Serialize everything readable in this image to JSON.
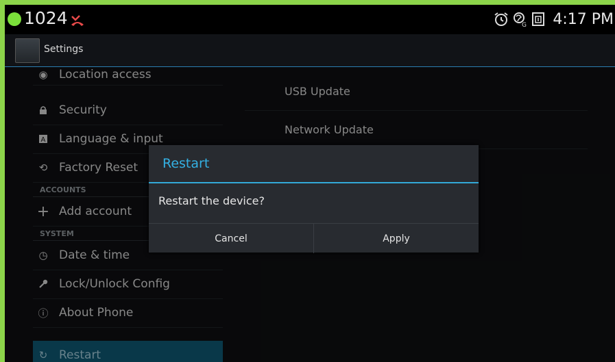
{
  "status_bar": {
    "extension": "1024",
    "time": "4:17 PM",
    "icons": [
      "green-status-dot-icon",
      "missed-call-icon",
      "alarm-clock-icon",
      "gps-icon",
      "sim-slot-1-icon"
    ]
  },
  "action_bar": {
    "title": "Settings",
    "icon": "settings-app-icon"
  },
  "sidebar": {
    "items": [
      {
        "label": "Location access",
        "icon": "location-icon"
      },
      {
        "label": "Security",
        "icon": "lock-icon"
      },
      {
        "label": "Language & input",
        "icon": "keyboard-icon"
      },
      {
        "label": "Factory Reset",
        "icon": "factory-reset-icon"
      },
      {
        "label": "ACCOUNTS",
        "header": true
      },
      {
        "label": "Add account",
        "icon": "plus-icon"
      },
      {
        "label": "SYSTEM",
        "header": true
      },
      {
        "label": "Date & time",
        "icon": "clock-icon"
      },
      {
        "label": "Lock/Unlock Config",
        "icon": "key-icon"
      },
      {
        "label": "About Phone",
        "icon": "info-icon"
      },
      {
        "label": "Restart",
        "icon": "restart-icon",
        "selected": true
      }
    ]
  },
  "right_panel": {
    "items": [
      {
        "label": "USB Update"
      },
      {
        "label": "Network Update"
      }
    ]
  },
  "dialog": {
    "title": "Restart",
    "message": "Restart the device?",
    "cancel_label": "Cancel",
    "apply_label": "Apply"
  },
  "colors": {
    "accent": "#33b5e5",
    "selected_bg": "#0f5670",
    "frame": "#8cd44a"
  }
}
